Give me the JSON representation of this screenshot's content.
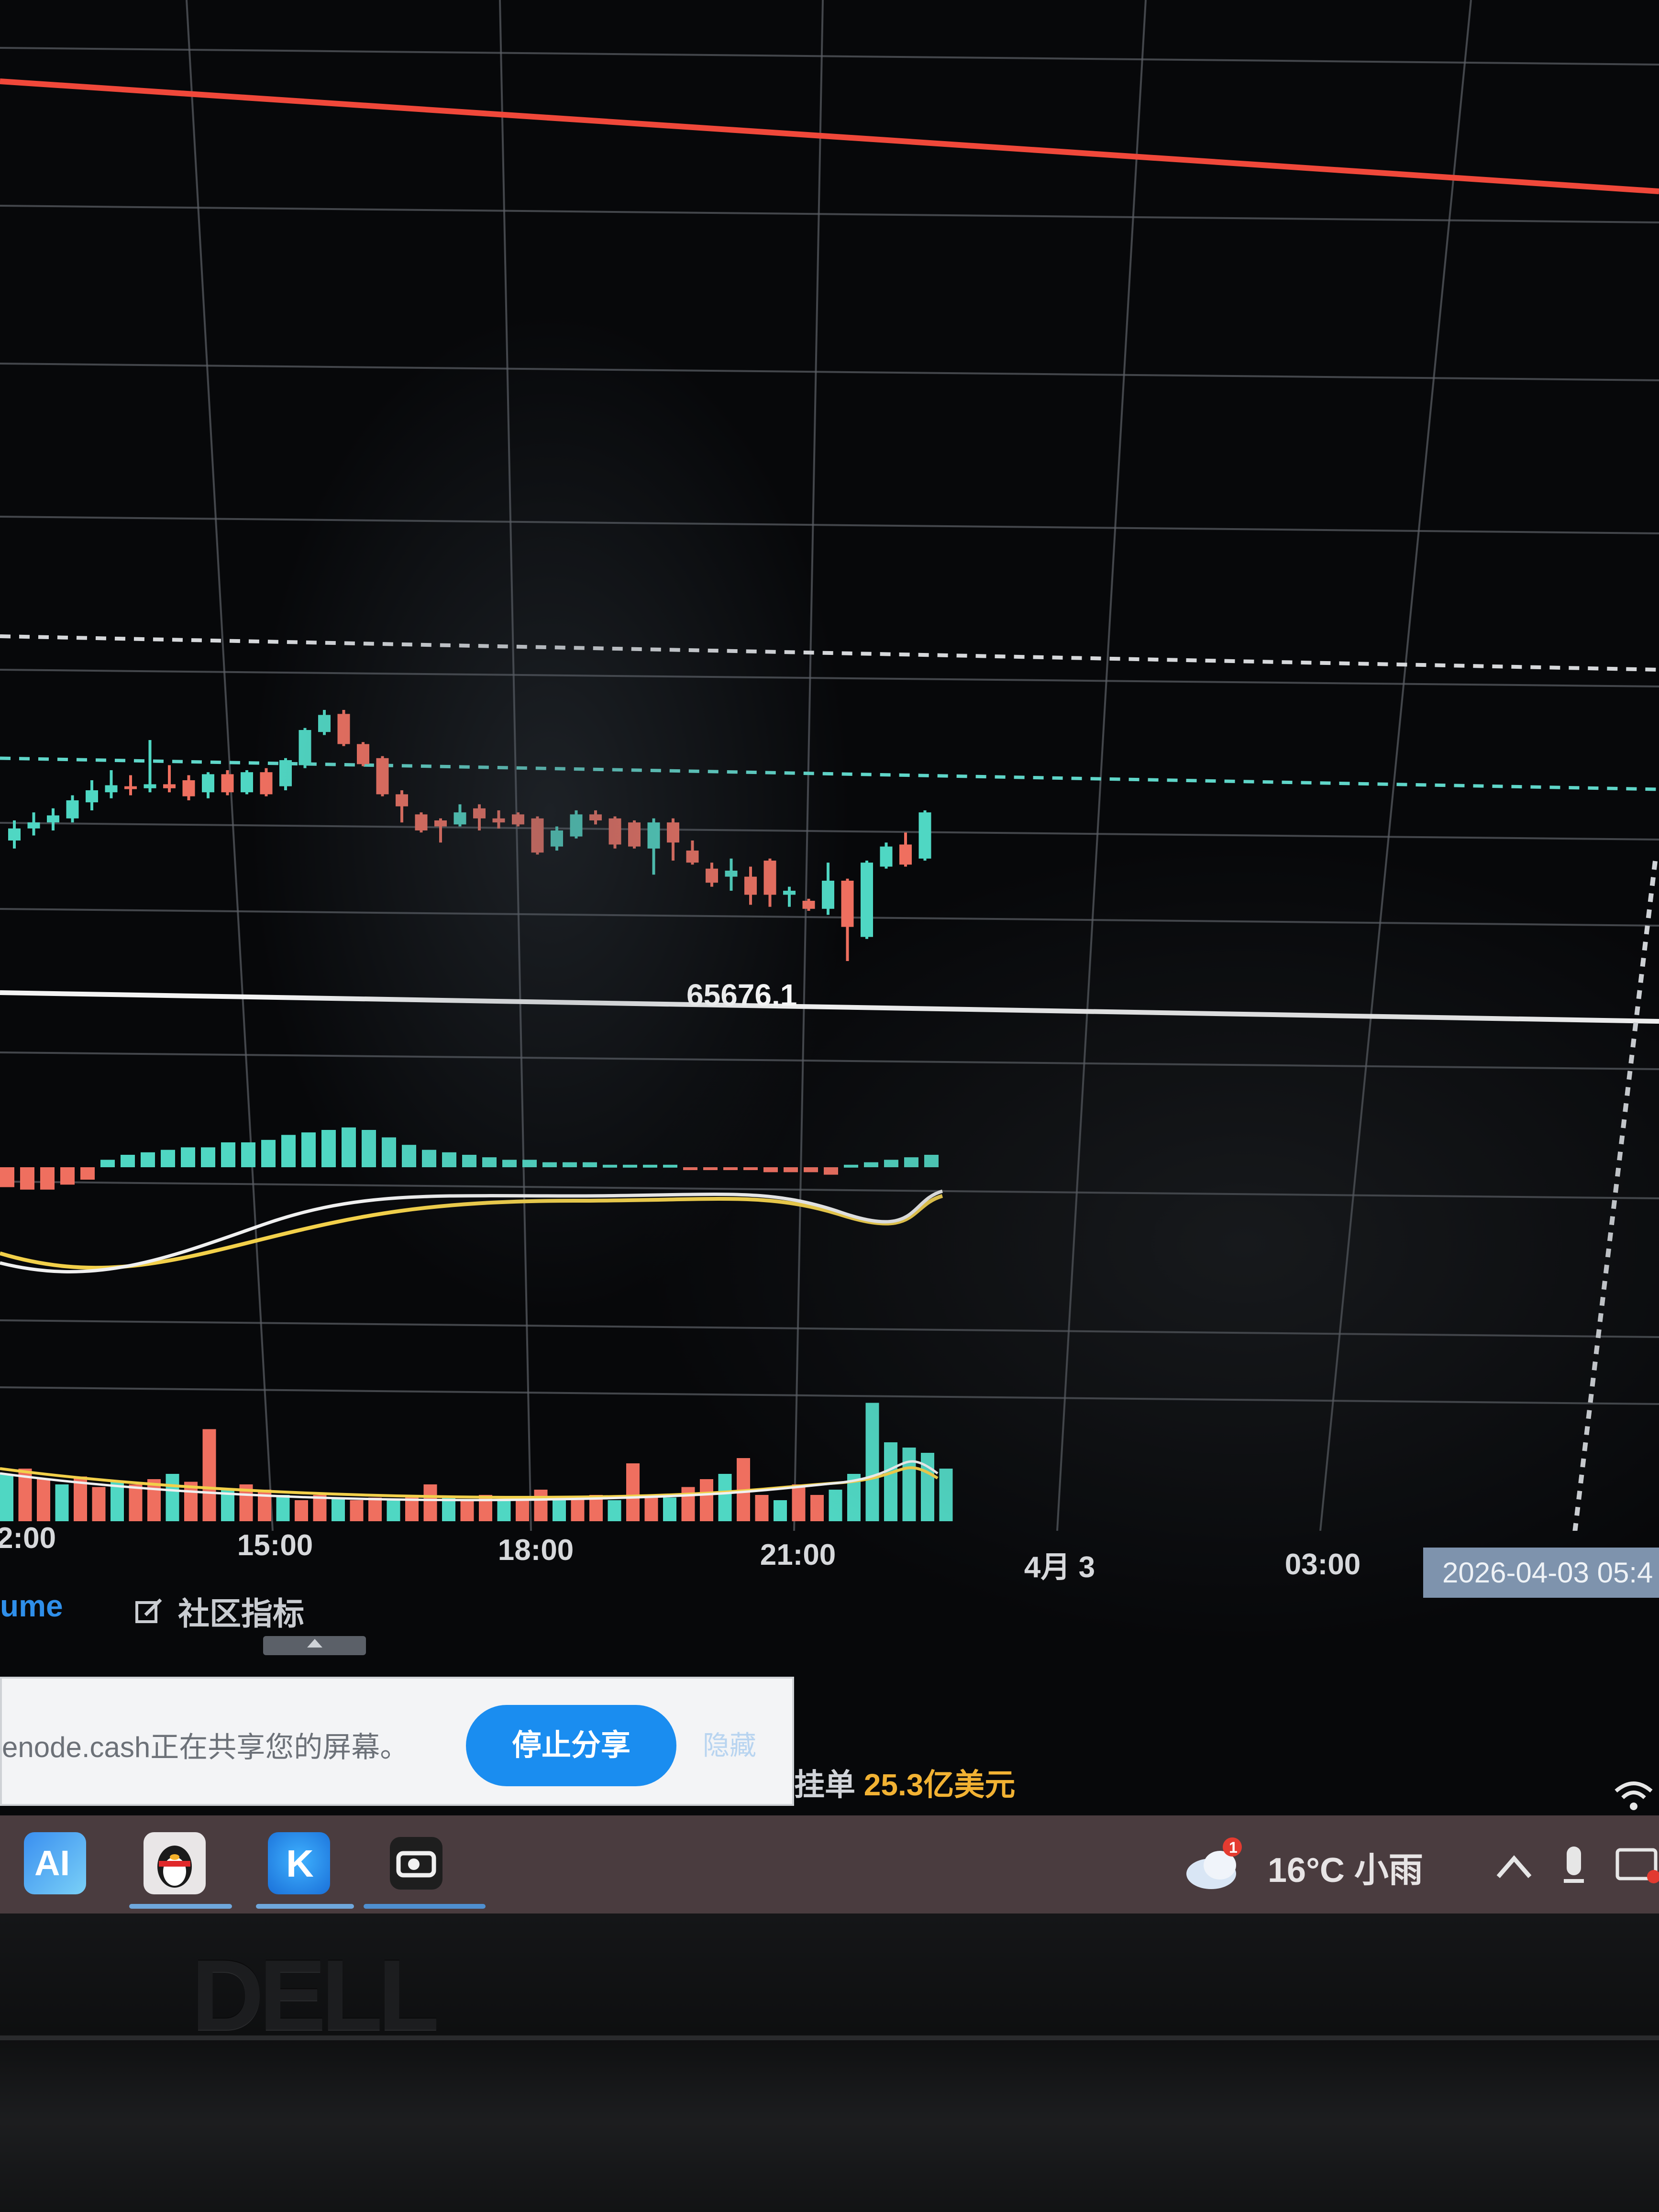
{
  "chart_data": {
    "type": "candlestick",
    "x_tick_labels": [
      "2:00",
      "15:00",
      "18:00",
      "21:00",
      "4月 3",
      "03:00"
    ],
    "crosshair_time_label": "2026-04-03 05:4",
    "min_price_label": "65676.1",
    "candles": [
      {
        "o": 30,
        "c": 42,
        "h": 50,
        "l": 22
      },
      {
        "o": 42,
        "c": 48,
        "h": 58,
        "l": 35
      },
      {
        "o": 48,
        "c": 55,
        "h": 62,
        "l": 40
      },
      {
        "o": 52,
        "c": 70,
        "h": 75,
        "l": 48
      },
      {
        "o": 68,
        "c": 80,
        "h": 90,
        "l": 60
      },
      {
        "o": 78,
        "c": 85,
        "h": 100,
        "l": 72
      },
      {
        "o": 84,
        "c": 82,
        "h": 95,
        "l": 75
      },
      {
        "o": 82,
        "c": 86,
        "h": 130,
        "l": 78
      },
      {
        "o": 86,
        "c": 82,
        "h": 105,
        "l": 78
      },
      {
        "o": 90,
        "c": 74,
        "h": 95,
        "l": 70
      },
      {
        "o": 78,
        "c": 96,
        "h": 98,
        "l": 72
      },
      {
        "o": 96,
        "c": 78,
        "h": 100,
        "l": 75
      },
      {
        "o": 78,
        "c": 98,
        "h": 100,
        "l": 76
      },
      {
        "o": 98,
        "c": 76,
        "h": 102,
        "l": 74
      },
      {
        "o": 84,
        "c": 110,
        "h": 112,
        "l": 80
      },
      {
        "o": 105,
        "c": 140,
        "h": 142,
        "l": 102
      },
      {
        "o": 138,
        "c": 155,
        "h": 160,
        "l": 135
      },
      {
        "o": 156,
        "c": 126,
        "h": 160,
        "l": 124
      },
      {
        "o": 126,
        "c": 106,
        "h": 128,
        "l": 104
      },
      {
        "o": 112,
        "c": 76,
        "h": 114,
        "l": 74
      },
      {
        "o": 76,
        "c": 64,
        "h": 80,
        "l": 48
      },
      {
        "o": 56,
        "c": 40,
        "h": 58,
        "l": 38
      },
      {
        "o": 50,
        "c": 44,
        "h": 52,
        "l": 28
      },
      {
        "o": 46,
        "c": 58,
        "h": 66,
        "l": 44
      },
      {
        "o": 62,
        "c": 52,
        "h": 66,
        "l": 40
      },
      {
        "o": 52,
        "c": 48,
        "h": 60,
        "l": 42
      },
      {
        "o": 56,
        "c": 46,
        "h": 58,
        "l": 44
      },
      {
        "o": 52,
        "c": 18,
        "h": 54,
        "l": 16
      },
      {
        "o": 24,
        "c": 40,
        "h": 44,
        "l": 20
      },
      {
        "o": 34,
        "c": 56,
        "h": 60,
        "l": 32
      },
      {
        "o": 56,
        "c": 50,
        "h": 60,
        "l": 46
      },
      {
        "o": 52,
        "c": 26,
        "h": 54,
        "l": 22
      },
      {
        "o": 48,
        "c": 24,
        "h": 50,
        "l": 22
      },
      {
        "o": 22,
        "c": 48,
        "h": 52,
        "l": -4
      },
      {
        "o": 48,
        "c": 28,
        "h": 52,
        "l": 10
      },
      {
        "o": 20,
        "c": 8,
        "h": 30,
        "l": 6
      },
      {
        "o": 2,
        "c": -12,
        "h": 8,
        "l": -16
      },
      {
        "o": -6,
        "c": 0,
        "h": 12,
        "l": -20
      },
      {
        "o": -6,
        "c": -24,
        "h": 4,
        "l": -34
      },
      {
        "o": 10,
        "c": -24,
        "h": 12,
        "l": -36
      },
      {
        "o": -24,
        "c": -20,
        "h": -16,
        "l": -36
      },
      {
        "o": -30,
        "c": -38,
        "h": -28,
        "l": -40
      },
      {
        "o": -38,
        "c": -10,
        "h": 8,
        "l": -44
      },
      {
        "o": -10,
        "c": -56,
        "h": -8,
        "l": -90
      },
      {
        "o": -66,
        "c": 8,
        "h": 10,
        "l": -68
      },
      {
        "o": 4,
        "c": 24,
        "h": 28,
        "l": 2
      },
      {
        "o": 26,
        "c": 6,
        "h": 38,
        "l": 4
      },
      {
        "o": 12,
        "c": 58,
        "h": 60,
        "l": 10
      }
    ],
    "macd_hist": [
      -8,
      -9,
      -9,
      -7,
      -5,
      3,
      5,
      6,
      7,
      8,
      8,
      10,
      10,
      11,
      13,
      14,
      15,
      16,
      15,
      12,
      9,
      7,
      6,
      5,
      4,
      3,
      3,
      2,
      2,
      2,
      1,
      1,
      1,
      1,
      -1,
      -1,
      -1,
      -1,
      -2,
      -2,
      -2,
      -3,
      1,
      2,
      3,
      4,
      5
    ],
    "volume": [
      18,
      20,
      16,
      14,
      17,
      13,
      15,
      14,
      16,
      18,
      15,
      35,
      12,
      14,
      12,
      10,
      8,
      10,
      9,
      8,
      9,
      8,
      10,
      14,
      9,
      8,
      10,
      8,
      9,
      12,
      8,
      9,
      10,
      8,
      22,
      10,
      9,
      13,
      16,
      18,
      24,
      10,
      8,
      14,
      10,
      12,
      18,
      45,
      30,
      28,
      26,
      20
    ],
    "colors": {
      "up": "#4fd7c3",
      "down": "#ef6f5f",
      "grid": "#5d6167",
      "red_line": "#f0483a",
      "white_line": "#f4f4f4",
      "dash_white": "#d6d8db",
      "dash_cyan": "#5fd6c9",
      "macd_dif": "#f0f0f0",
      "macd_dea": "#f2d04a"
    }
  },
  "indicator_tabs": {
    "volume_label": "ume",
    "community_label": "社区指标"
  },
  "share_notice": {
    "message": "enode.cash正在共享您的屏幕。",
    "stop_button": "停止分享",
    "hide_button": "隐藏"
  },
  "order_info": {
    "label": "挂单",
    "value": "25.3亿美元"
  },
  "taskbar": {
    "apps": [
      {
        "name": "ai-app-icon",
        "label": "AI"
      },
      {
        "name": "qq-app-icon"
      },
      {
        "name": "k-app-icon",
        "label": "K"
      },
      {
        "name": "capture-app-icon"
      }
    ],
    "weather_badge": "1",
    "weather": "16°C 小雨"
  },
  "bezel_logo": "DELL"
}
